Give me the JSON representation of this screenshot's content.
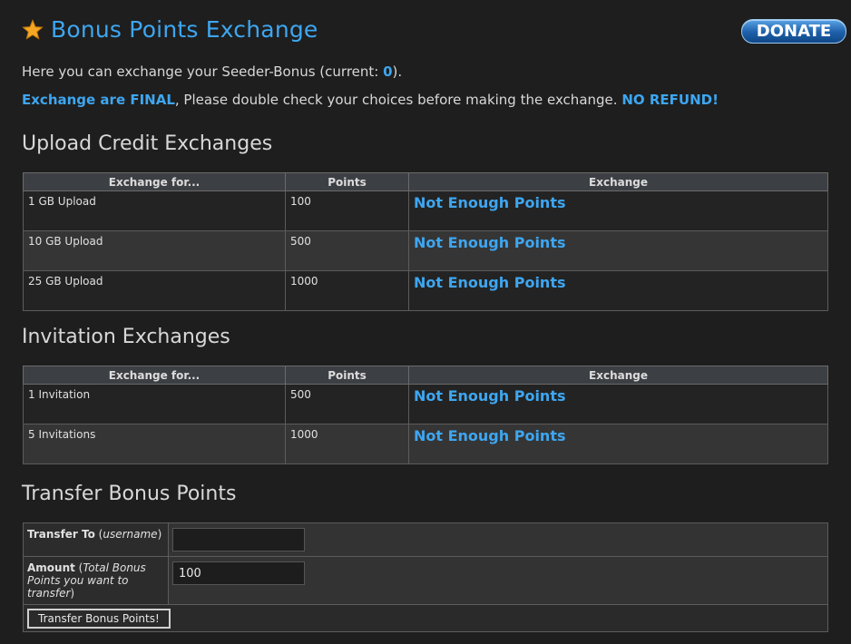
{
  "header": {
    "title": "Bonus Points Exchange",
    "donate_label": "DONATE",
    "colors": {
      "accent": "#3ea6f0",
      "background": "#1e1e1e"
    }
  },
  "intro": {
    "line1_prefix": "Here you can exchange your Seeder-Bonus (current: ",
    "current_points": "0",
    "line1_suffix": ").",
    "warning_strong1": "Exchange are FINAL",
    "warning_middle": ", Please double check your choices before making the exchange. ",
    "warning_strong2": "NO REFUND!"
  },
  "upload": {
    "title": "Upload Credit Exchanges",
    "headers": [
      "Exchange for...",
      "Points",
      "Exchange"
    ],
    "rows": [
      {
        "item": "1 GB Upload",
        "points": "100",
        "action": "Not Enough Points"
      },
      {
        "item": "10 GB Upload",
        "points": "500",
        "action": "Not Enough Points"
      },
      {
        "item": "25 GB Upload",
        "points": "1000",
        "action": "Not Enough Points"
      }
    ]
  },
  "invite": {
    "title": "Invitation Exchanges",
    "headers": [
      "Exchange for...",
      "Points",
      "Exchange"
    ],
    "rows": [
      {
        "item": "1 Invitation",
        "points": "500",
        "action": "Not Enough Points"
      },
      {
        "item": "5 Invitations",
        "points": "1000",
        "action": "Not Enough Points"
      }
    ]
  },
  "transfer": {
    "title": "Transfer Bonus Points",
    "to_label": "Transfer To",
    "to_hint": "username",
    "to_value": "",
    "amount_label": "Amount",
    "amount_hint": "Total Bonus Points you want to transfer",
    "amount_value": "100",
    "button_label": "Transfer Bonus Points!"
  }
}
